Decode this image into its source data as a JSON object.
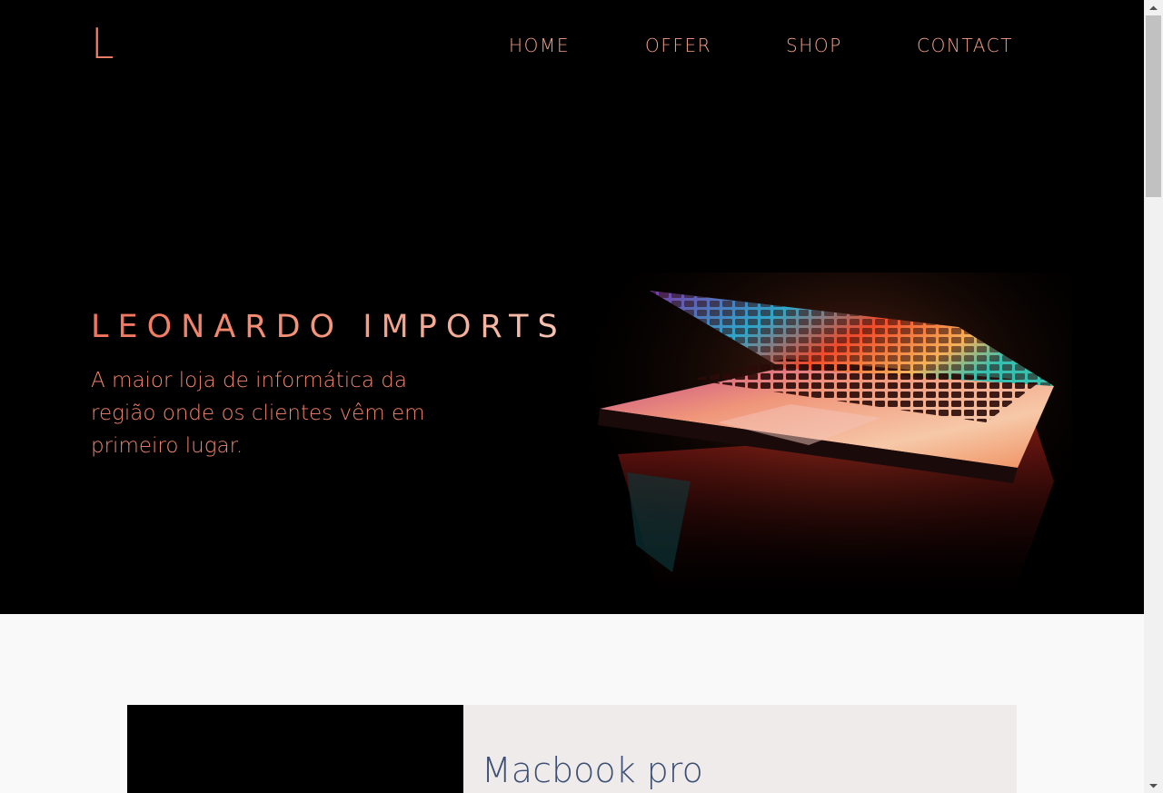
{
  "header": {
    "logo": "L",
    "nav": [
      {
        "label": "HOME"
      },
      {
        "label": "OFFER"
      },
      {
        "label": "SHOP"
      },
      {
        "label": "CONTACT"
      }
    ]
  },
  "hero": {
    "title": "LEONARDO IMPORTS",
    "subtitle": "A maior loja de informática da região onde os clientes vêm em primeiro lugar.",
    "image_icon": "laptop-photo"
  },
  "products": {
    "first": {
      "name": "Macbook pro"
    }
  },
  "colors": {
    "accent": "#f2826a",
    "hero_bg": "#000000",
    "product_title": "#3c4f75",
    "card_bg": "#efebea",
    "page_bg": "#f9f9f9"
  }
}
